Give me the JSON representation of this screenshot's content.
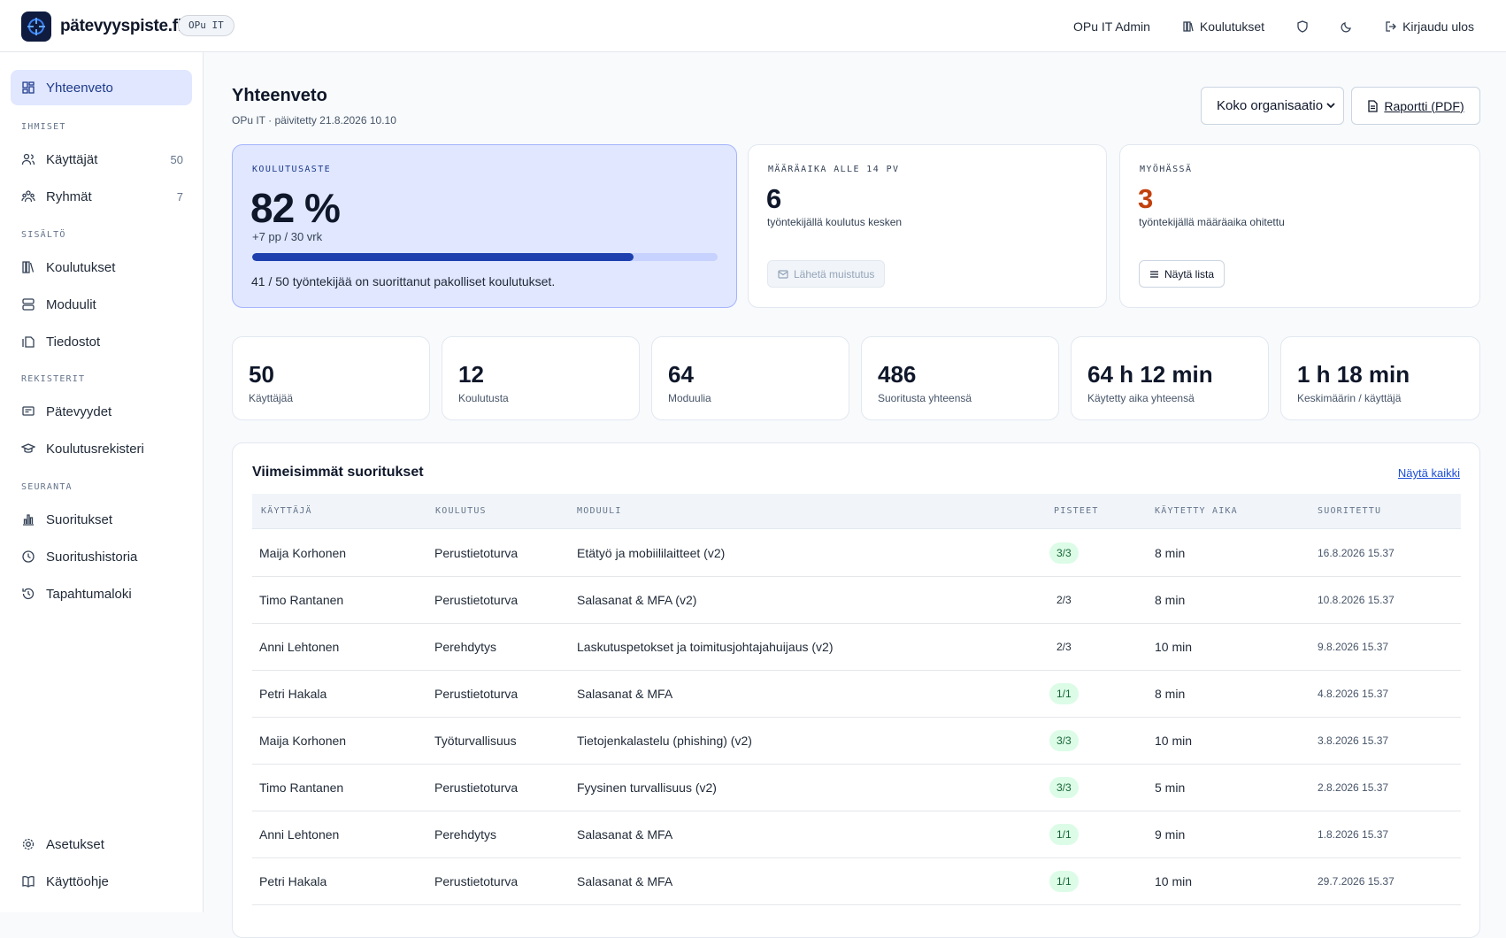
{
  "app": {
    "brand": "pätevyyspiste.fi",
    "org_badge": "OPu IT"
  },
  "topnav": {
    "user": "OPu IT Admin",
    "trainings": "Koulutukset",
    "logout": "Kirjaudu ulos"
  },
  "sidebar": {
    "overview": "Yhteenveto",
    "sections": {
      "people": "IHMISET",
      "content": "SISÄLTÖ",
      "registers": "REKISTERIT",
      "tracking": "SEURANTA"
    },
    "users": {
      "label": "Käyttäjät",
      "count": "50"
    },
    "groups": {
      "label": "Ryhmät",
      "count": "7"
    },
    "trainings": "Koulutukset",
    "modules": "Moduulit",
    "files": "Tiedostot",
    "competences": "Pätevyydet",
    "training_register": "Koulutusrekisteri",
    "completions": "Suoritukset",
    "completion_history": "Suoritushistoria",
    "event_log": "Tapahtumaloki",
    "settings": "Asetukset",
    "guide": "Käyttöohje"
  },
  "header": {
    "title": "Yhteenveto",
    "subtitle": "OPu IT · päivitetty 21.8.2026 10.10",
    "scope_select": "Koko organisaatio",
    "report_button": "Raportti (PDF)"
  },
  "hero": {
    "eyebrow": "KOULUTUSASTE",
    "value": "82 %",
    "delta": "+7 pp / 30 vrk",
    "progress": 0.82,
    "note": "41 / 50 työntekijää on suorittanut pakolliset koulutukset."
  },
  "due_card": {
    "eyebrow": "MÄÄRÄAIKA ALLE 14 PV",
    "value": "6",
    "sub": "työntekijällä koulutus kesken",
    "button": "Lähetä muistutus"
  },
  "late_card": {
    "eyebrow": "MYÖHÄSSÄ",
    "value": "3",
    "sub": "työntekijällä määräaika ohitettu",
    "button": "Näytä lista",
    "accent_color": "#c2410c"
  },
  "stats": [
    {
      "value": "50",
      "label": "Käyttäjää"
    },
    {
      "value": "12",
      "label": "Koulutusta"
    },
    {
      "value": "64",
      "label": "Moduulia"
    },
    {
      "value": "486",
      "label": "Suoritusta yhteensä"
    },
    {
      "value": "64 h 12 min",
      "label": "Käytetty aika yhteensä"
    },
    {
      "value": "1 h 18 min",
      "label": "Keskimäärin / käyttäjä"
    }
  ],
  "recent": {
    "title": "Viimeisimmät suoritukset",
    "show_all": "Näytä kaikki",
    "columns": [
      "KÄYTTÄJÄ",
      "KOULUTUS",
      "MODUULI",
      "PISTEET",
      "KÄYTETTY AIKA",
      "SUORITETTU"
    ],
    "rows": [
      {
        "user": "Maija Korhonen",
        "training": "Perustietoturva",
        "module": "Etätyö ja mobiililaitteet (v2)",
        "score": "3/3",
        "full": true,
        "time": "8 min",
        "date": "16.8.2026 15.37"
      },
      {
        "user": "Timo Rantanen",
        "training": "Perustietoturva",
        "module": "Salasanat & MFA (v2)",
        "score": "2/3",
        "full": false,
        "time": "8 min",
        "date": "10.8.2026 15.37"
      },
      {
        "user": "Anni Lehtonen",
        "training": "Perehdytys",
        "module": "Laskutuspetokset ja toimitusjohtajahuijaus (v2)",
        "score": "2/3",
        "full": false,
        "time": "10 min",
        "date": "9.8.2026 15.37"
      },
      {
        "user": "Petri Hakala",
        "training": "Perustietoturva",
        "module": "Salasanat & MFA",
        "score": "1/1",
        "full": true,
        "time": "8 min",
        "date": "4.8.2026 15.37"
      },
      {
        "user": "Maija Korhonen",
        "training": "Työturvallisuus",
        "module": "Tietojenkalastelu (phishing) (v2)",
        "score": "3/3",
        "full": true,
        "time": "10 min",
        "date": "3.8.2026 15.37"
      },
      {
        "user": "Timo Rantanen",
        "training": "Perustietoturva",
        "module": "Fyysinen turvallisuus (v2)",
        "score": "3/3",
        "full": true,
        "time": "5 min",
        "date": "2.8.2026 15.37"
      },
      {
        "user": "Anni Lehtonen",
        "training": "Perehdytys",
        "module": "Salasanat & MFA",
        "score": "1/1",
        "full": true,
        "time": "9 min",
        "date": "1.8.2026 15.37"
      },
      {
        "user": "Petri Hakala",
        "training": "Perustietoturva",
        "module": "Salasanat & MFA",
        "score": "1/1",
        "full": true,
        "time": "10 min",
        "date": "29.7.2026 15.37"
      }
    ]
  }
}
